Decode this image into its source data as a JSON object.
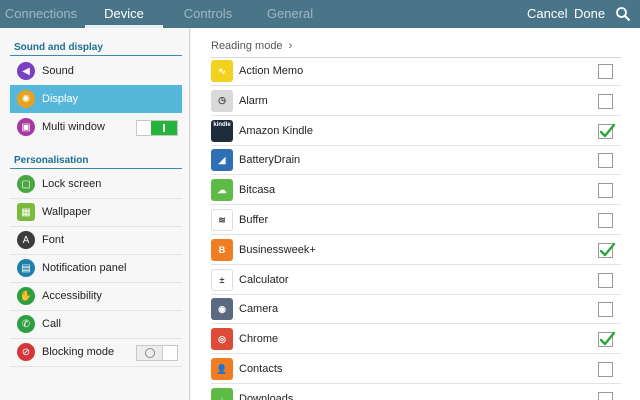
{
  "tabs": [
    "Connections",
    "Device",
    "Controls",
    "General"
  ],
  "actions": {
    "cancel": "Cancel",
    "done": "Done"
  },
  "left": {
    "section1": "Sound and display",
    "section2": "Personalisation",
    "items": [
      {
        "label": "Sound",
        "icon": "speaker-icon",
        "color": "#7a3fc3"
      },
      {
        "label": "Display",
        "icon": "brightness-icon",
        "color": "#e8a220",
        "selected": true
      },
      {
        "label": "Multi window",
        "icon": "multi-window-icon",
        "color": "#a43a9e",
        "toggle": "on"
      },
      {
        "label": "Lock screen",
        "icon": "lock-screen-icon",
        "color": "#4aa543"
      },
      {
        "label": "Wallpaper",
        "icon": "wallpaper-icon",
        "color": "#7cba3d"
      },
      {
        "label": "Font",
        "icon": "font-icon",
        "color": "#3c3c3c"
      },
      {
        "label": "Notification panel",
        "icon": "notification-panel-icon",
        "color": "#1f7fa8"
      },
      {
        "label": "Accessibility",
        "icon": "hand-icon",
        "color": "#2f9e42"
      },
      {
        "label": "Call",
        "icon": "phone-icon",
        "color": "#2f9e42"
      },
      {
        "label": "Blocking mode",
        "icon": "blocking-mode-icon",
        "color": "#d3373a",
        "toggle": "off"
      }
    ]
  },
  "right": {
    "breadcrumb": "Reading mode",
    "apps": [
      {
        "label": "Action Memo",
        "icon": "action-memo-icon",
        "checked": false,
        "color": "#f2d21c",
        "glyph": "∿"
      },
      {
        "label": "Alarm",
        "icon": "alarm-clock-icon",
        "checked": false,
        "color": "#d9d9d9",
        "glyph": "◷"
      },
      {
        "label": "Amazon Kindle",
        "icon": "kindle-icon",
        "checked": true,
        "color": "#1e2c3b",
        "glyph": "kindle"
      },
      {
        "label": "BatteryDrain",
        "icon": "battery-drain-icon",
        "checked": false,
        "color": "#2f6fb5",
        "glyph": "◢"
      },
      {
        "label": "Bitcasa",
        "icon": "bitcasa-cloud-icon",
        "checked": false,
        "color": "#5dbb46",
        "glyph": "☁"
      },
      {
        "label": "Buffer",
        "icon": "buffer-icon",
        "checked": false,
        "color": "#ffffff",
        "glyph": "≋"
      },
      {
        "label": "Businessweek+",
        "icon": "businessweek-icon",
        "checked": true,
        "color": "#f07d22",
        "glyph": "B"
      },
      {
        "label": "Calculator",
        "icon": "calculator-icon",
        "checked": false,
        "color": "#ffffff",
        "glyph": "±"
      },
      {
        "label": "Camera",
        "icon": "camera-icon",
        "checked": false,
        "color": "#5a6a80",
        "glyph": "◉"
      },
      {
        "label": "Chrome",
        "icon": "chrome-icon",
        "checked": true,
        "color": "#dd4b39",
        "glyph": "◎"
      },
      {
        "label": "Contacts",
        "icon": "contacts-icon",
        "checked": false,
        "color": "#f07d22",
        "glyph": "👤"
      },
      {
        "label": "Downloads",
        "icon": "downloads-icon",
        "checked": false,
        "color": "#5dbb46",
        "glyph": "↓"
      }
    ]
  }
}
